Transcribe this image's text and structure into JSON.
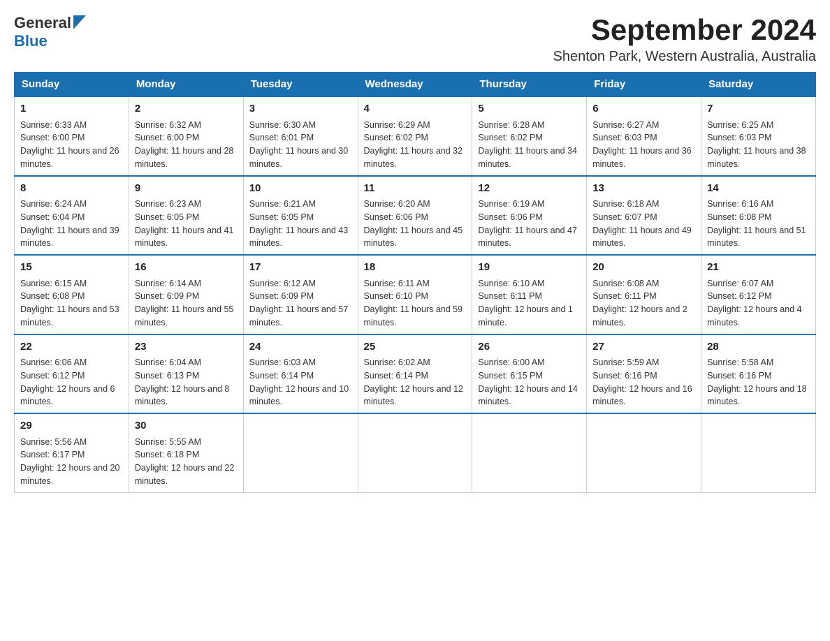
{
  "logo": {
    "general": "General",
    "blue": "Blue"
  },
  "title": "September 2024",
  "location": "Shenton Park, Western Australia, Australia",
  "days_of_week": [
    "Sunday",
    "Monday",
    "Tuesday",
    "Wednesday",
    "Thursday",
    "Friday",
    "Saturday"
  ],
  "weeks": [
    [
      {
        "day": "1",
        "sunrise": "6:33 AM",
        "sunset": "6:00 PM",
        "daylight": "11 hours and 26 minutes."
      },
      {
        "day": "2",
        "sunrise": "6:32 AM",
        "sunset": "6:00 PM",
        "daylight": "11 hours and 28 minutes."
      },
      {
        "day": "3",
        "sunrise": "6:30 AM",
        "sunset": "6:01 PM",
        "daylight": "11 hours and 30 minutes."
      },
      {
        "day": "4",
        "sunrise": "6:29 AM",
        "sunset": "6:02 PM",
        "daylight": "11 hours and 32 minutes."
      },
      {
        "day": "5",
        "sunrise": "6:28 AM",
        "sunset": "6:02 PM",
        "daylight": "11 hours and 34 minutes."
      },
      {
        "day": "6",
        "sunrise": "6:27 AM",
        "sunset": "6:03 PM",
        "daylight": "11 hours and 36 minutes."
      },
      {
        "day": "7",
        "sunrise": "6:25 AM",
        "sunset": "6:03 PM",
        "daylight": "11 hours and 38 minutes."
      }
    ],
    [
      {
        "day": "8",
        "sunrise": "6:24 AM",
        "sunset": "6:04 PM",
        "daylight": "11 hours and 39 minutes."
      },
      {
        "day": "9",
        "sunrise": "6:23 AM",
        "sunset": "6:05 PM",
        "daylight": "11 hours and 41 minutes."
      },
      {
        "day": "10",
        "sunrise": "6:21 AM",
        "sunset": "6:05 PM",
        "daylight": "11 hours and 43 minutes."
      },
      {
        "day": "11",
        "sunrise": "6:20 AM",
        "sunset": "6:06 PM",
        "daylight": "11 hours and 45 minutes."
      },
      {
        "day": "12",
        "sunrise": "6:19 AM",
        "sunset": "6:06 PM",
        "daylight": "11 hours and 47 minutes."
      },
      {
        "day": "13",
        "sunrise": "6:18 AM",
        "sunset": "6:07 PM",
        "daylight": "11 hours and 49 minutes."
      },
      {
        "day": "14",
        "sunrise": "6:16 AM",
        "sunset": "6:08 PM",
        "daylight": "11 hours and 51 minutes."
      }
    ],
    [
      {
        "day": "15",
        "sunrise": "6:15 AM",
        "sunset": "6:08 PM",
        "daylight": "11 hours and 53 minutes."
      },
      {
        "day": "16",
        "sunrise": "6:14 AM",
        "sunset": "6:09 PM",
        "daylight": "11 hours and 55 minutes."
      },
      {
        "day": "17",
        "sunrise": "6:12 AM",
        "sunset": "6:09 PM",
        "daylight": "11 hours and 57 minutes."
      },
      {
        "day": "18",
        "sunrise": "6:11 AM",
        "sunset": "6:10 PM",
        "daylight": "11 hours and 59 minutes."
      },
      {
        "day": "19",
        "sunrise": "6:10 AM",
        "sunset": "6:11 PM",
        "daylight": "12 hours and 1 minute."
      },
      {
        "day": "20",
        "sunrise": "6:08 AM",
        "sunset": "6:11 PM",
        "daylight": "12 hours and 2 minutes."
      },
      {
        "day": "21",
        "sunrise": "6:07 AM",
        "sunset": "6:12 PM",
        "daylight": "12 hours and 4 minutes."
      }
    ],
    [
      {
        "day": "22",
        "sunrise": "6:06 AM",
        "sunset": "6:12 PM",
        "daylight": "12 hours and 6 minutes."
      },
      {
        "day": "23",
        "sunrise": "6:04 AM",
        "sunset": "6:13 PM",
        "daylight": "12 hours and 8 minutes."
      },
      {
        "day": "24",
        "sunrise": "6:03 AM",
        "sunset": "6:14 PM",
        "daylight": "12 hours and 10 minutes."
      },
      {
        "day": "25",
        "sunrise": "6:02 AM",
        "sunset": "6:14 PM",
        "daylight": "12 hours and 12 minutes."
      },
      {
        "day": "26",
        "sunrise": "6:00 AM",
        "sunset": "6:15 PM",
        "daylight": "12 hours and 14 minutes."
      },
      {
        "day": "27",
        "sunrise": "5:59 AM",
        "sunset": "6:16 PM",
        "daylight": "12 hours and 16 minutes."
      },
      {
        "day": "28",
        "sunrise": "5:58 AM",
        "sunset": "6:16 PM",
        "daylight": "12 hours and 18 minutes."
      }
    ],
    [
      {
        "day": "29",
        "sunrise": "5:56 AM",
        "sunset": "6:17 PM",
        "daylight": "12 hours and 20 minutes."
      },
      {
        "day": "30",
        "sunrise": "5:55 AM",
        "sunset": "6:18 PM",
        "daylight": "12 hours and 22 minutes."
      },
      null,
      null,
      null,
      null,
      null
    ]
  ],
  "labels": {
    "sunrise": "Sunrise:",
    "sunset": "Sunset:",
    "daylight": "Daylight:"
  }
}
